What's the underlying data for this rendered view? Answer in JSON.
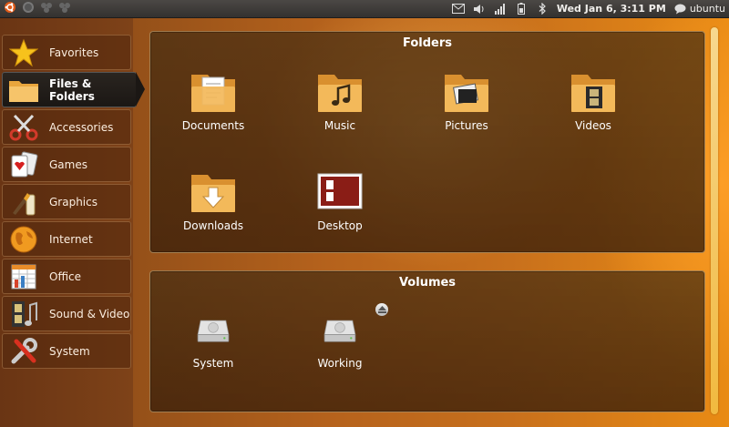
{
  "top_panel": {
    "clock": "Wed Jan  6,  3:11 PM",
    "user": "ubuntu",
    "icons": [
      "ubuntu-logo-icon",
      "firefox-icon",
      "group-icon",
      "group-icon",
      "mail-icon",
      "volume-icon",
      "signal-icon",
      "battery-icon",
      "bluetooth-icon",
      "chat-icon"
    ]
  },
  "sidebar": {
    "items": [
      {
        "label": "Favorites",
        "icon": "star-icon"
      },
      {
        "label": "Files & Folders",
        "icon": "folder-icon",
        "active": true
      },
      {
        "label": "Accessories",
        "icon": "scissors-icon"
      },
      {
        "label": "Games",
        "icon": "cards-icon"
      },
      {
        "label": "Graphics",
        "icon": "paintbrush-icon"
      },
      {
        "label": "Internet",
        "icon": "globe-icon"
      },
      {
        "label": "Office",
        "icon": "spreadsheet-icon"
      },
      {
        "label": "Sound & Video",
        "icon": "filmstrip-icon"
      },
      {
        "label": "System",
        "icon": "tools-icon"
      }
    ]
  },
  "folders": {
    "title": "Folders",
    "items": [
      {
        "label": "Documents",
        "icon": "documents-folder-icon"
      },
      {
        "label": "Music",
        "icon": "music-folder-icon"
      },
      {
        "label": "Pictures",
        "icon": "pictures-folder-icon"
      },
      {
        "label": "Videos",
        "icon": "videos-folder-icon"
      },
      {
        "label": "Downloads",
        "icon": "downloads-folder-icon"
      },
      {
        "label": "Desktop",
        "icon": "desktop-icon"
      }
    ]
  },
  "volumes": {
    "title": "Volumes",
    "items": [
      {
        "label": "System",
        "icon": "hard-drive-icon"
      },
      {
        "label": "Working",
        "icon": "hard-drive-icon"
      }
    ]
  }
}
